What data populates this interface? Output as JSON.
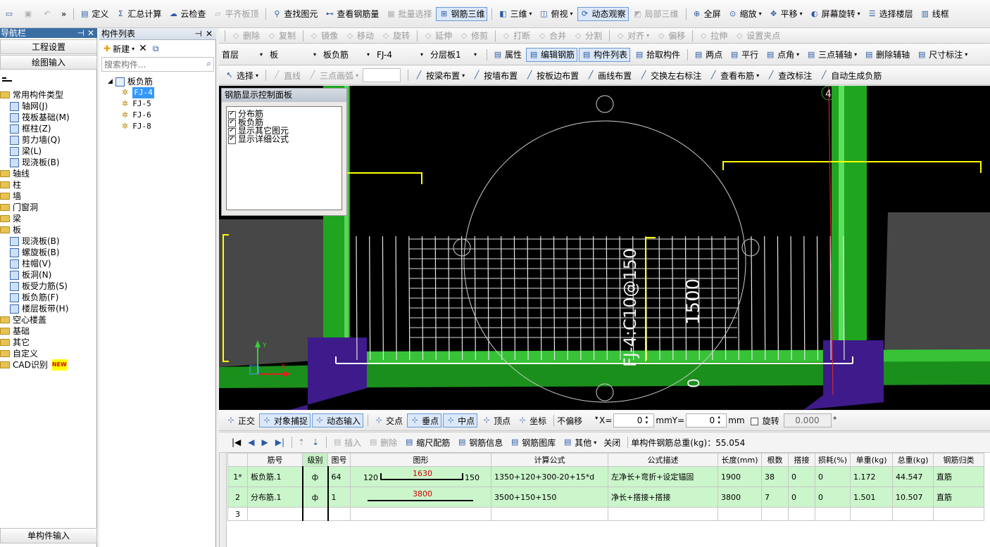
{
  "colors": {
    "canvas": "#000000",
    "beam_green": "#1fa51f",
    "column_purple": "#3e1a8a",
    "rebar_yellow": "#ffff00",
    "mesh_white": "#e6e6e6",
    "grid_row": "#cbf5cb"
  },
  "toolbar1": [
    {
      "icon": "folder-open-icon",
      "label": "",
      "dis": false
    },
    {
      "icon": "save-icon",
      "label": "",
      "dis": true
    },
    {
      "icon": "undo-icon",
      "label": "",
      "dis": true
    },
    {
      "icon": "overflow-icon",
      "label": "»",
      "dis": false
    },
    {
      "icon": "define-icon",
      "label": "定义",
      "dis": false
    },
    {
      "icon": "sum-icon",
      "label": "汇总计算",
      "dis": false
    },
    {
      "icon": "cloud-check-icon",
      "label": "云检查",
      "dis": false
    },
    {
      "icon": "align-slab-top-icon",
      "label": "平齐板顶",
      "dis": true
    },
    {
      "icon": "find-element-icon",
      "label": "查找图元",
      "dis": false
    },
    {
      "icon": "view-rebar-qty-icon",
      "label": "查看钢筋量",
      "dis": false
    },
    {
      "icon": "batch-select-icon",
      "label": "批量选择",
      "dis": true
    },
    {
      "icon": "rebar-3d-icon",
      "label": "钢筋三维",
      "dis": false,
      "on": true
    },
    {
      "icon": "cube-3d-icon",
      "label": "三维",
      "dis": false,
      "dd": true
    },
    {
      "icon": "top-view-icon",
      "label": "俯视",
      "dis": false,
      "dd": true
    },
    {
      "icon": "dynamic-view-icon",
      "label": "动态观察",
      "dis": false,
      "on": true
    },
    {
      "icon": "local-3d-icon",
      "label": "局部三维",
      "dis": true
    },
    {
      "icon": "fullscreen-icon",
      "label": "全屏",
      "dis": false
    },
    {
      "icon": "zoom-icon",
      "label": "缩放",
      "dis": false,
      "dd": true
    },
    {
      "icon": "pan-icon",
      "label": "平移",
      "dis": false,
      "dd": true
    },
    {
      "icon": "screen-rotate-icon",
      "label": "屏幕旋转",
      "dis": false,
      "dd": true
    },
    {
      "icon": "select-floor-icon",
      "label": "选择楼层",
      "dis": false
    },
    {
      "icon": "wireframe-icon",
      "label": "线框",
      "dis": false
    }
  ],
  "nav": {
    "title": "导航栏",
    "sections": [
      "工程设置",
      "绘图输入"
    ],
    "bottom": "单构件输入",
    "tree": [
      {
        "lvl": 0,
        "type": "folder",
        "label": "常用构件类型"
      },
      {
        "lvl": 1,
        "type": "item",
        "label": "轴网(J)"
      },
      {
        "lvl": 1,
        "type": "item",
        "label": "筏板基础(M)"
      },
      {
        "lvl": 1,
        "type": "item",
        "label": "框柱(Z)"
      },
      {
        "lvl": 1,
        "type": "item",
        "label": "剪力墙(Q)"
      },
      {
        "lvl": 1,
        "type": "item",
        "label": "梁(L)"
      },
      {
        "lvl": 1,
        "type": "item",
        "label": "现浇板(B)"
      },
      {
        "lvl": 0,
        "type": "folder",
        "label": "轴线"
      },
      {
        "lvl": 0,
        "type": "folder",
        "label": "柱"
      },
      {
        "lvl": 0,
        "type": "folder",
        "label": "墙"
      },
      {
        "lvl": 0,
        "type": "folder",
        "label": "门窗洞"
      },
      {
        "lvl": 0,
        "type": "folder",
        "label": "梁"
      },
      {
        "lvl": 0,
        "type": "folder",
        "label": "板"
      },
      {
        "lvl": 1,
        "type": "item",
        "label": "现浇板(B)"
      },
      {
        "lvl": 1,
        "type": "item",
        "label": "螺旋板(B)"
      },
      {
        "lvl": 1,
        "type": "item",
        "label": "柱帽(V)"
      },
      {
        "lvl": 1,
        "type": "item",
        "label": "板洞(N)"
      },
      {
        "lvl": 1,
        "type": "item",
        "label": "板受力筋(S)"
      },
      {
        "lvl": 1,
        "type": "item",
        "label": "板负筋(F)"
      },
      {
        "lvl": 1,
        "type": "item",
        "label": "楼层板带(H)"
      },
      {
        "lvl": 0,
        "type": "folder",
        "label": "空心楼盖"
      },
      {
        "lvl": 0,
        "type": "folder",
        "label": "基础"
      },
      {
        "lvl": 0,
        "type": "folder",
        "label": "其它"
      },
      {
        "lvl": 0,
        "type": "folder",
        "label": "自定义"
      },
      {
        "lvl": 0,
        "type": "folder",
        "label": "CAD识别",
        "badge": "NEW"
      }
    ]
  },
  "components": {
    "title": "构件列表",
    "new_label": "新建",
    "search_placeholder": "搜索构件...",
    "root": "板负筋",
    "items": [
      "FJ-4",
      "FJ-5",
      "FJ-6",
      "FJ-8"
    ],
    "selected": "FJ-4"
  },
  "toolbar2": [
    "删除",
    "复制",
    "镜像",
    "移动",
    "旋转",
    "延伸",
    "修剪",
    "打断",
    "合并",
    "分割",
    "对齐",
    "偏移",
    "拉伸",
    "设置夹点"
  ],
  "toolbar3": {
    "floor": "首层",
    "category": "板",
    "type": "板负筋",
    "name": "FJ-4",
    "layer": "分层板1",
    "buttons": [
      "属性",
      "编辑钢筋",
      "构件列表",
      "拾取构件",
      "两点",
      "平行",
      "点角",
      "三点辅轴",
      "删除辅轴",
      "尺寸标注"
    ]
  },
  "toolbar4": [
    "选择",
    "直线",
    "三点画弧",
    "按梁布置",
    "按墙布置",
    "按板边布置",
    "画线布置",
    "交换左右标注",
    "查看布筋",
    "查改标注",
    "自动生成负筋"
  ],
  "control_panel": {
    "title": "钢筋显示控制面板",
    "options": [
      "分布筋",
      "板负筋",
      "显示其它图元",
      "显示详细公式"
    ]
  },
  "canvas": {
    "label_main": "FJ-4:C10@150",
    "label_len": "1500",
    "label_zero": "0",
    "axis_mark": "4"
  },
  "status": {
    "items": [
      "正交",
      "对象捕捉",
      "动态输入",
      "交点",
      "垂点",
      "中点",
      "顶点",
      "坐标"
    ],
    "offset_mode": "不偏移",
    "x_label": "X=",
    "x_val": "0",
    "y_label": "Y=",
    "y_val": "0",
    "unit": "mm",
    "rotate_label": "旋转",
    "rotate_val": "0.000"
  },
  "grid_toolbar": {
    "items": [
      "插入",
      "删除",
      "缩尺配筋",
      "钢筋信息",
      "钢筋图库",
      "其他",
      "关闭"
    ],
    "total": "单构件钢筋总重(kg)：55.054"
  },
  "table": {
    "headers": [
      "",
      "筋号",
      "级别",
      "图号",
      "图形",
      "计算公式",
      "公式描述",
      "长度(mm)",
      "根数",
      "搭接",
      "损耗(%)",
      "单重(kg)",
      "总重(kg)",
      "钢筋归类"
    ],
    "rows": [
      {
        "idx": "1*",
        "name": "板负筋.1",
        "grade": "ф",
        "fig": "64",
        "shape_l": "120",
        "shape_m": "1630",
        "shape_r": "150",
        "formula": "1350+120+300-20+15*d",
        "desc": "左净长+弯折+设定锚固",
        "length": "1900",
        "count": "38",
        "lap": "0",
        "loss": "0",
        "unit_w": "1.172",
        "total_w": "44.547",
        "cat": "直筋"
      },
      {
        "idx": "2",
        "name": "分布筋.1",
        "grade": "ф",
        "fig": "1",
        "shape_l": "",
        "shape_m": "3800",
        "shape_r": "",
        "formula": "3500+150+150",
        "desc": "净长+搭接+搭接",
        "length": "3800",
        "count": "7",
        "lap": "0",
        "loss": "0",
        "unit_w": "1.501",
        "total_w": "10.507",
        "cat": "直筋"
      },
      {
        "idx": "3",
        "name": "",
        "grade": "",
        "fig": "",
        "shape_l": "",
        "shape_m": "",
        "shape_r": "",
        "formula": "",
        "desc": "",
        "length": "",
        "count": "",
        "lap": "",
        "loss": "",
        "unit_w": "",
        "total_w": "",
        "cat": ""
      }
    ]
  }
}
